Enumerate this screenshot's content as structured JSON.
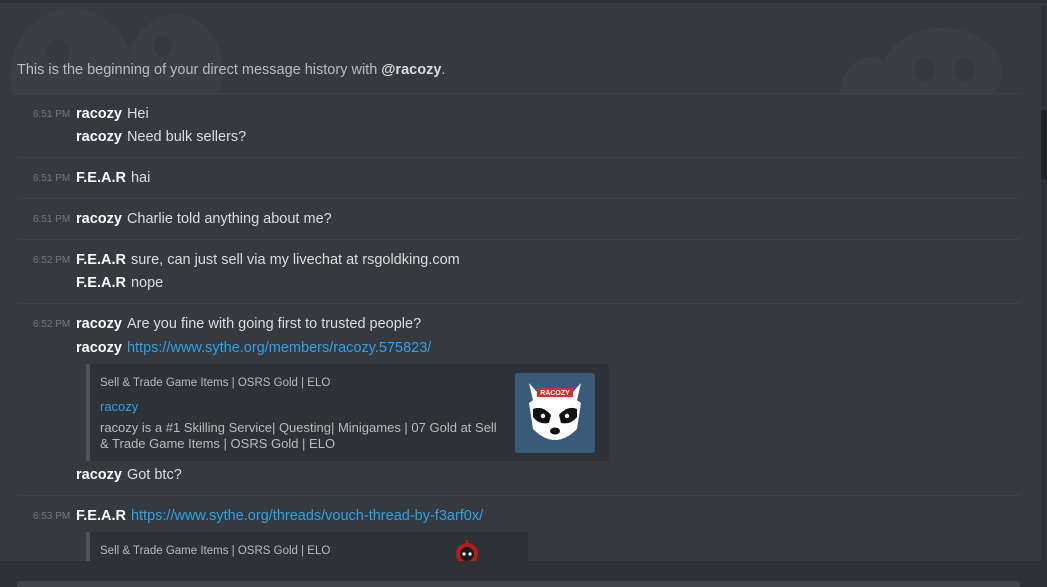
{
  "intro": {
    "prefix": "This is the beginning of your direct message history with ",
    "mention": "@racozy",
    "suffix": "."
  },
  "messages": [
    {
      "time": "6:51 PM",
      "lines": [
        {
          "author": "racozy",
          "text": "Hei"
        },
        {
          "author": "racozy",
          "text": "Need bulk sellers?"
        }
      ]
    },
    {
      "time": "6:51 PM",
      "lines": [
        {
          "author": "F.E.A.R",
          "text": "hai"
        }
      ]
    },
    {
      "time": "6:51 PM",
      "lines": [
        {
          "author": "racozy",
          "text": "Charlie told anything about me?"
        }
      ]
    },
    {
      "time": "6:52 PM",
      "lines": [
        {
          "author": "F.E.A.R",
          "text": "sure, can just sell via my livechat at rsgoldking.com"
        },
        {
          "author": "F.E.A.R",
          "text": "nope"
        }
      ]
    },
    {
      "time": "6:52 PM",
      "lines": [
        {
          "author": "racozy",
          "text": "Are you fine with going first to trusted people?"
        },
        {
          "author": "racozy",
          "link": "https://www.sythe.org/members/racozy.575823/"
        },
        {
          "author": "racozy",
          "text": "Got btc?"
        }
      ]
    },
    {
      "time": "6:53 PM",
      "lines": [
        {
          "author": "F.E.A.R",
          "link": "https://www.sythe.org/threads/vouch-thread-by-f3arf0x/"
        }
      ]
    }
  ],
  "embeds": [
    {
      "provider": "Sell & Trade Game Items | OSRS Gold | ELO",
      "title": "racozy",
      "description": "racozy is a #1 Skilling Service| Questing| Minigames | 07 Gold at Sell & Trade Game Items | OSRS Gold | ELO",
      "thumb_label": "RACOZY",
      "thumb_icon": "raccoon-logo-icon"
    },
    {
      "provider": "Sell & Trade Game Items | OSRS Gold | ELO",
      "thumb_icon": "red-mascot-icon"
    }
  ],
  "colors": {
    "background": "#36393f",
    "link": "#2ea2e6",
    "author": "#ffffff",
    "timestamp": "#72767d"
  }
}
